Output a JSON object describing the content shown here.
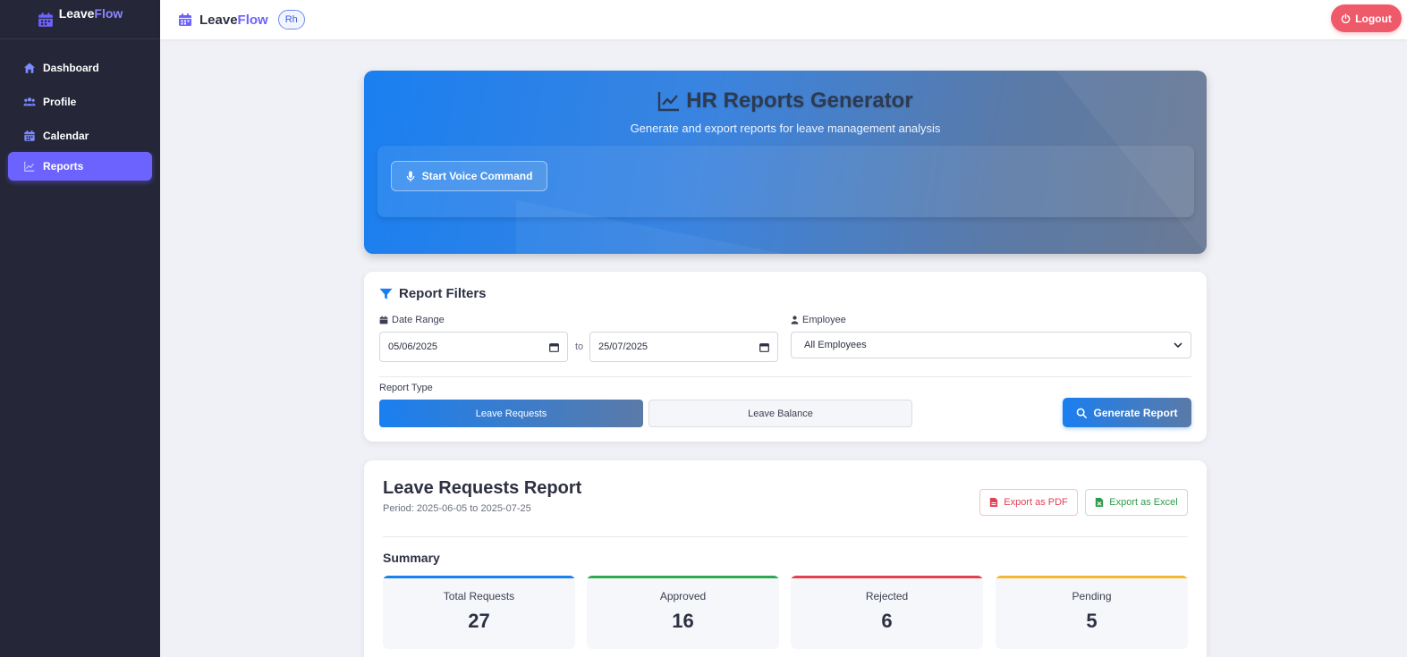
{
  "brand": {
    "part1": "Leave",
    "part2": "Flow"
  },
  "sidebar": {
    "items": [
      {
        "label": "Dashboard",
        "icon": "home-icon"
      },
      {
        "label": "Profile",
        "icon": "users-icon"
      },
      {
        "label": "Calendar",
        "icon": "calendar-icon"
      },
      {
        "label": "Reports",
        "icon": "chart-icon",
        "active": true
      }
    ]
  },
  "header": {
    "role_badge": "Rh",
    "logout_label": "Logout"
  },
  "hero": {
    "title": "HR Reports Generator",
    "subtitle": "Generate and export reports for leave management analysis",
    "voice_label": "Start Voice Command"
  },
  "filters": {
    "title": "Report Filters",
    "date_range_label": "Date Range",
    "date_from": "05/06/2025",
    "date_to": "25/07/2025",
    "to_label": "to",
    "employee_label": "Employee",
    "employee_selected": "All Employees",
    "report_type_label": "Report Type",
    "report_types": [
      "Leave Requests",
      "Leave Balance"
    ],
    "generate_label": "Generate Report"
  },
  "report": {
    "title": "Leave Requests Report",
    "period": "Period: 2025-06-05 to 2025-07-25",
    "export_pdf": "Export as PDF",
    "export_excel": "Export as Excel",
    "summary_label": "Summary",
    "stats": [
      {
        "label": "Total Requests",
        "value": "27",
        "color": "#1a7ff0"
      },
      {
        "label": "Approved",
        "value": "16",
        "color": "#2fa84f"
      },
      {
        "label": "Rejected",
        "value": "6",
        "color": "#e5404f"
      },
      {
        "label": "Pending",
        "value": "5",
        "color": "#f5b731"
      }
    ]
  },
  "colors": {
    "accent": "#6c63ff",
    "sidebar_bg": "#252638",
    "primary_blue": "#1a7ff0",
    "logout": "#ef5a6a"
  }
}
